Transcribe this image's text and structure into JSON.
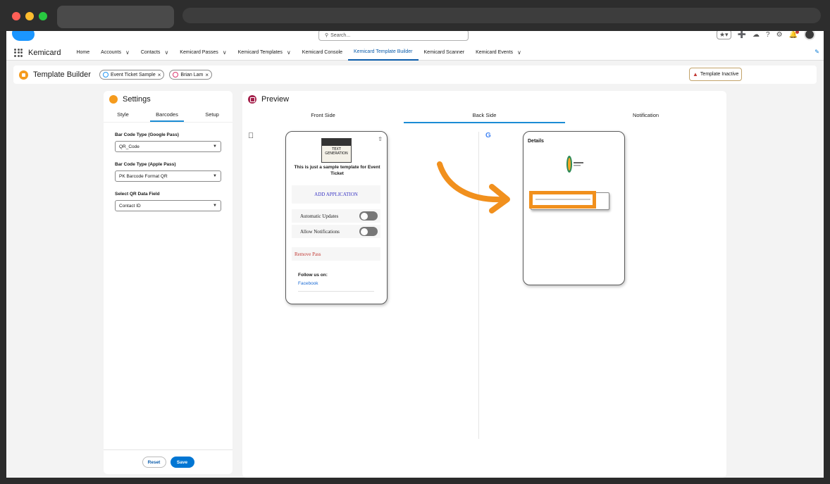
{
  "topbar": {
    "search_placeholder": "Search..."
  },
  "nav": {
    "app_name": "Kemicard",
    "items": [
      {
        "label": "Home",
        "dropdown": false
      },
      {
        "label": "Accounts",
        "dropdown": true
      },
      {
        "label": "Contacts",
        "dropdown": true
      },
      {
        "label": "Kemicard Passes",
        "dropdown": true
      },
      {
        "label": "Kemicard Templates",
        "dropdown": true
      },
      {
        "label": "Kemicard Console",
        "dropdown": false
      },
      {
        "label": "Kemicard Template Builder",
        "dropdown": false,
        "active": true
      },
      {
        "label": "Kemicard Scanner",
        "dropdown": false
      },
      {
        "label": "Kemicard Events",
        "dropdown": true
      }
    ]
  },
  "header": {
    "title": "Template Builder",
    "pills": [
      "Event Ticket Sample",
      "Brian Lam"
    ],
    "status": "Template Inactive"
  },
  "settings": {
    "title": "Settings",
    "tabs": [
      "Style",
      "Barcodes",
      "Setup"
    ],
    "active_tab": "Barcodes",
    "fields": [
      {
        "label": "Bar Code Type (Google Pass)",
        "value": "QR_Code"
      },
      {
        "label": "Bar Code Type (Apple Pass)",
        "value": "PK Barcode Format QR"
      },
      {
        "label": "Select QR Data Field",
        "value": "Contact ID"
      }
    ],
    "reset_label": "Reset",
    "save_label": "Save"
  },
  "preview": {
    "title": "Preview",
    "tabs": [
      "Front Side",
      "Back Side",
      "Notification"
    ],
    "active_tab": "Back Side",
    "apple_card": {
      "thumb_text": "TEXT\nGENERATION",
      "description": "This is just a sample template for Event Ticket",
      "add_application": "ADD APPLICATION",
      "toggle_1": "Automatic Updates",
      "toggle_2": "Allow Notifications",
      "remove": "Remove Pass",
      "follow": "Follow us on:",
      "facebook": "Facebook"
    },
    "google_card": {
      "details": "Details"
    }
  },
  "colors": {
    "highlight": "#f1901d",
    "accent": "#0176d3",
    "tab_underline": "#1b8cd4"
  }
}
